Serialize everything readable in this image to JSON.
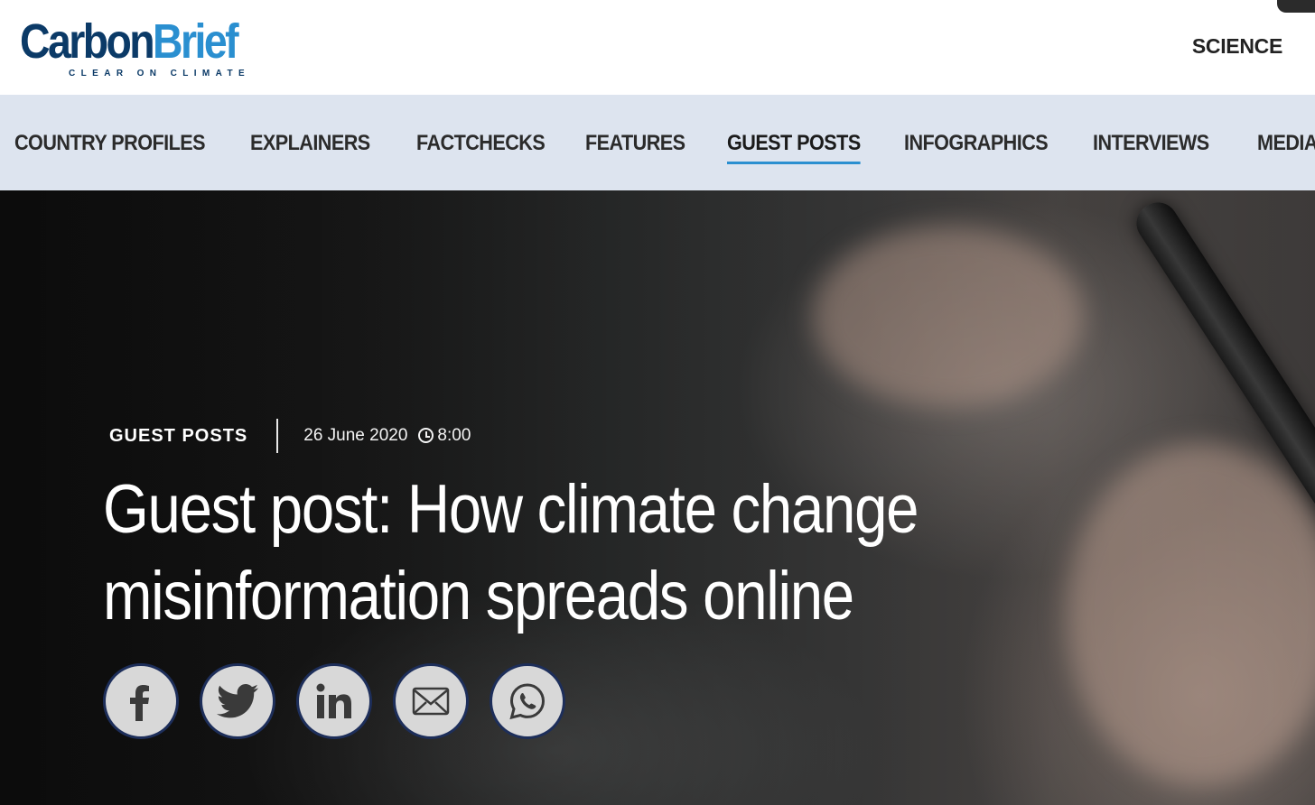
{
  "brand": {
    "name_part1": "Carbon",
    "name_part2": "Brief",
    "tagline": "CLEAR ON CLIMATE",
    "colors": {
      "navy": "#0b3a67",
      "blue": "#2a8fd0"
    }
  },
  "top_nav": {
    "science_label": "SCIENCE"
  },
  "nav": {
    "items": [
      {
        "label": "COUNTRY PROFILES"
      },
      {
        "label": "EXPLAINERS"
      },
      {
        "label": "FACTCHECKS"
      },
      {
        "label": "FEATURES"
      },
      {
        "label": "GUEST POSTS",
        "active": true
      },
      {
        "label": "INFOGRAPHICS"
      },
      {
        "label": "INTERVIEWS"
      },
      {
        "label": "MEDIA"
      }
    ],
    "active_color": "#2a8fd0"
  },
  "article": {
    "category": "GUEST POSTS",
    "date": "26 June 2020",
    "time": "8:00",
    "title_line1": "Guest post: How climate change",
    "title_line2": "misinformation spreads online"
  },
  "share": {
    "buttons": [
      {
        "icon": "facebook-icon"
      },
      {
        "icon": "twitter-icon"
      },
      {
        "icon": "linkedin-icon"
      },
      {
        "icon": "email-icon"
      },
      {
        "icon": "whatsapp-icon"
      }
    ]
  }
}
